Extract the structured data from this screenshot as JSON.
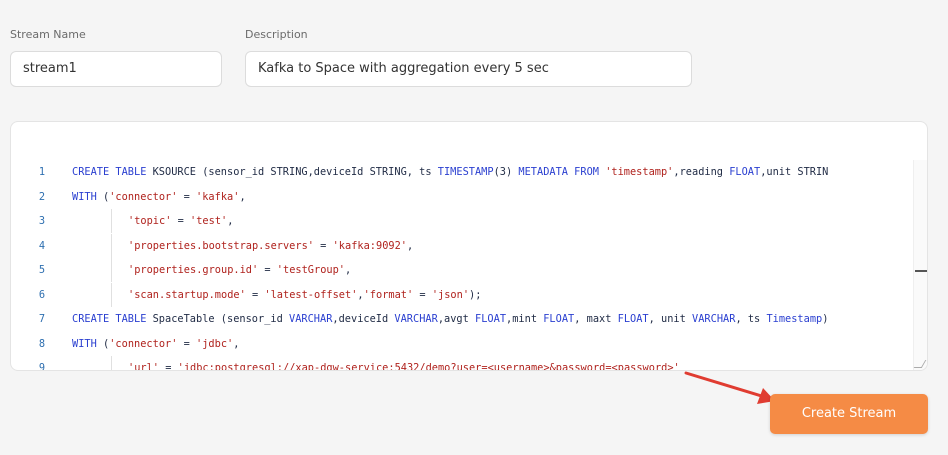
{
  "form": {
    "stream_name_label": "Stream Name",
    "stream_name_value": "stream1",
    "description_label": "Description",
    "description_value": "Kafka to Space with aggregation every 5 sec",
    "create_button_label": "Create Stream"
  },
  "editor": {
    "lines": [
      {
        "n": "1",
        "indent": 0,
        "tokens": [
          {
            "t": "CREATE TABLE",
            "c": "kw"
          },
          {
            "t": " KSOURCE (sensor_id STRING,deviceId STRING, ts ",
            "c": ""
          },
          {
            "t": "TIMESTAMP",
            "c": "kw"
          },
          {
            "t": "(3) ",
            "c": ""
          },
          {
            "t": "METADATA FROM",
            "c": "kw"
          },
          {
            "t": " ",
            "c": ""
          },
          {
            "t": "'timestamp'",
            "c": "str"
          },
          {
            "t": ",reading ",
            "c": ""
          },
          {
            "t": "FLOAT",
            "c": "kw"
          },
          {
            "t": ",unit STRIN",
            "c": ""
          }
        ]
      },
      {
        "n": "2",
        "indent": 0,
        "tokens": [
          {
            "t": "WITH",
            "c": "kw"
          },
          {
            "t": " (",
            "c": ""
          },
          {
            "t": "'connector'",
            "c": "str"
          },
          {
            "t": " = ",
            "c": ""
          },
          {
            "t": "'kafka'",
            "c": "str"
          },
          {
            "t": ",",
            "c": ""
          }
        ]
      },
      {
        "n": "3",
        "indent": 1,
        "tokens": [
          {
            "t": "'topic'",
            "c": "str"
          },
          {
            "t": " = ",
            "c": ""
          },
          {
            "t": "'test'",
            "c": "str"
          },
          {
            "t": ",",
            "c": ""
          }
        ]
      },
      {
        "n": "4",
        "indent": 1,
        "tokens": [
          {
            "t": "'properties.bootstrap.servers'",
            "c": "str"
          },
          {
            "t": " = ",
            "c": ""
          },
          {
            "t": "'kafka:9092'",
            "c": "str"
          },
          {
            "t": ",",
            "c": ""
          }
        ]
      },
      {
        "n": "5",
        "indent": 1,
        "tokens": [
          {
            "t": "'properties.group.id'",
            "c": "str"
          },
          {
            "t": " = ",
            "c": ""
          },
          {
            "t": "'testGroup'",
            "c": "str"
          },
          {
            "t": ",",
            "c": ""
          }
        ]
      },
      {
        "n": "6",
        "indent": 1,
        "tokens": [
          {
            "t": "'scan.startup.mode'",
            "c": "str"
          },
          {
            "t": " = ",
            "c": ""
          },
          {
            "t": "'latest-offset'",
            "c": "str"
          },
          {
            "t": ",",
            "c": ""
          },
          {
            "t": "'format'",
            "c": "str"
          },
          {
            "t": " = ",
            "c": ""
          },
          {
            "t": "'json'",
            "c": "str"
          },
          {
            "t": ");",
            "c": ""
          }
        ]
      },
      {
        "n": "7",
        "indent": 0,
        "tokens": [
          {
            "t": "CREATE TABLE",
            "c": "kw"
          },
          {
            "t": " SpaceTable (sensor_id ",
            "c": ""
          },
          {
            "t": "VARCHAR",
            "c": "kw"
          },
          {
            "t": ",deviceId ",
            "c": ""
          },
          {
            "t": "VARCHAR",
            "c": "kw"
          },
          {
            "t": ",avgt ",
            "c": ""
          },
          {
            "t": "FLOAT",
            "c": "kw"
          },
          {
            "t": ",mint ",
            "c": ""
          },
          {
            "t": "FLOAT",
            "c": "kw"
          },
          {
            "t": ", maxt ",
            "c": ""
          },
          {
            "t": "FLOAT",
            "c": "kw"
          },
          {
            "t": ", unit ",
            "c": ""
          },
          {
            "t": "VARCHAR",
            "c": "kw"
          },
          {
            "t": ", ts ",
            "c": ""
          },
          {
            "t": "Timestamp",
            "c": "kw"
          },
          {
            "t": ")",
            "c": ""
          }
        ]
      },
      {
        "n": "8",
        "indent": 0,
        "tokens": [
          {
            "t": "WITH",
            "c": "kw"
          },
          {
            "t": " (",
            "c": ""
          },
          {
            "t": "'connector'",
            "c": "str"
          },
          {
            "t": " = ",
            "c": ""
          },
          {
            "t": "'jdbc'",
            "c": "str"
          },
          {
            "t": ",",
            "c": ""
          }
        ]
      },
      {
        "n": "9",
        "indent": 1,
        "tokens": [
          {
            "t": "'url'",
            "c": "str"
          },
          {
            "t": " = ",
            "c": ""
          },
          {
            "t": "'jdbc:postgresql://xap-dgw-service:5432/demo?user=<username>&password=<password>'",
            "c": "str"
          }
        ]
      }
    ]
  },
  "colors": {
    "accent": "#f58b45",
    "arrow": "#e03c31",
    "keyword": "#2a3fd0",
    "string": "#b0231e",
    "line_number": "#2e6fb0"
  }
}
